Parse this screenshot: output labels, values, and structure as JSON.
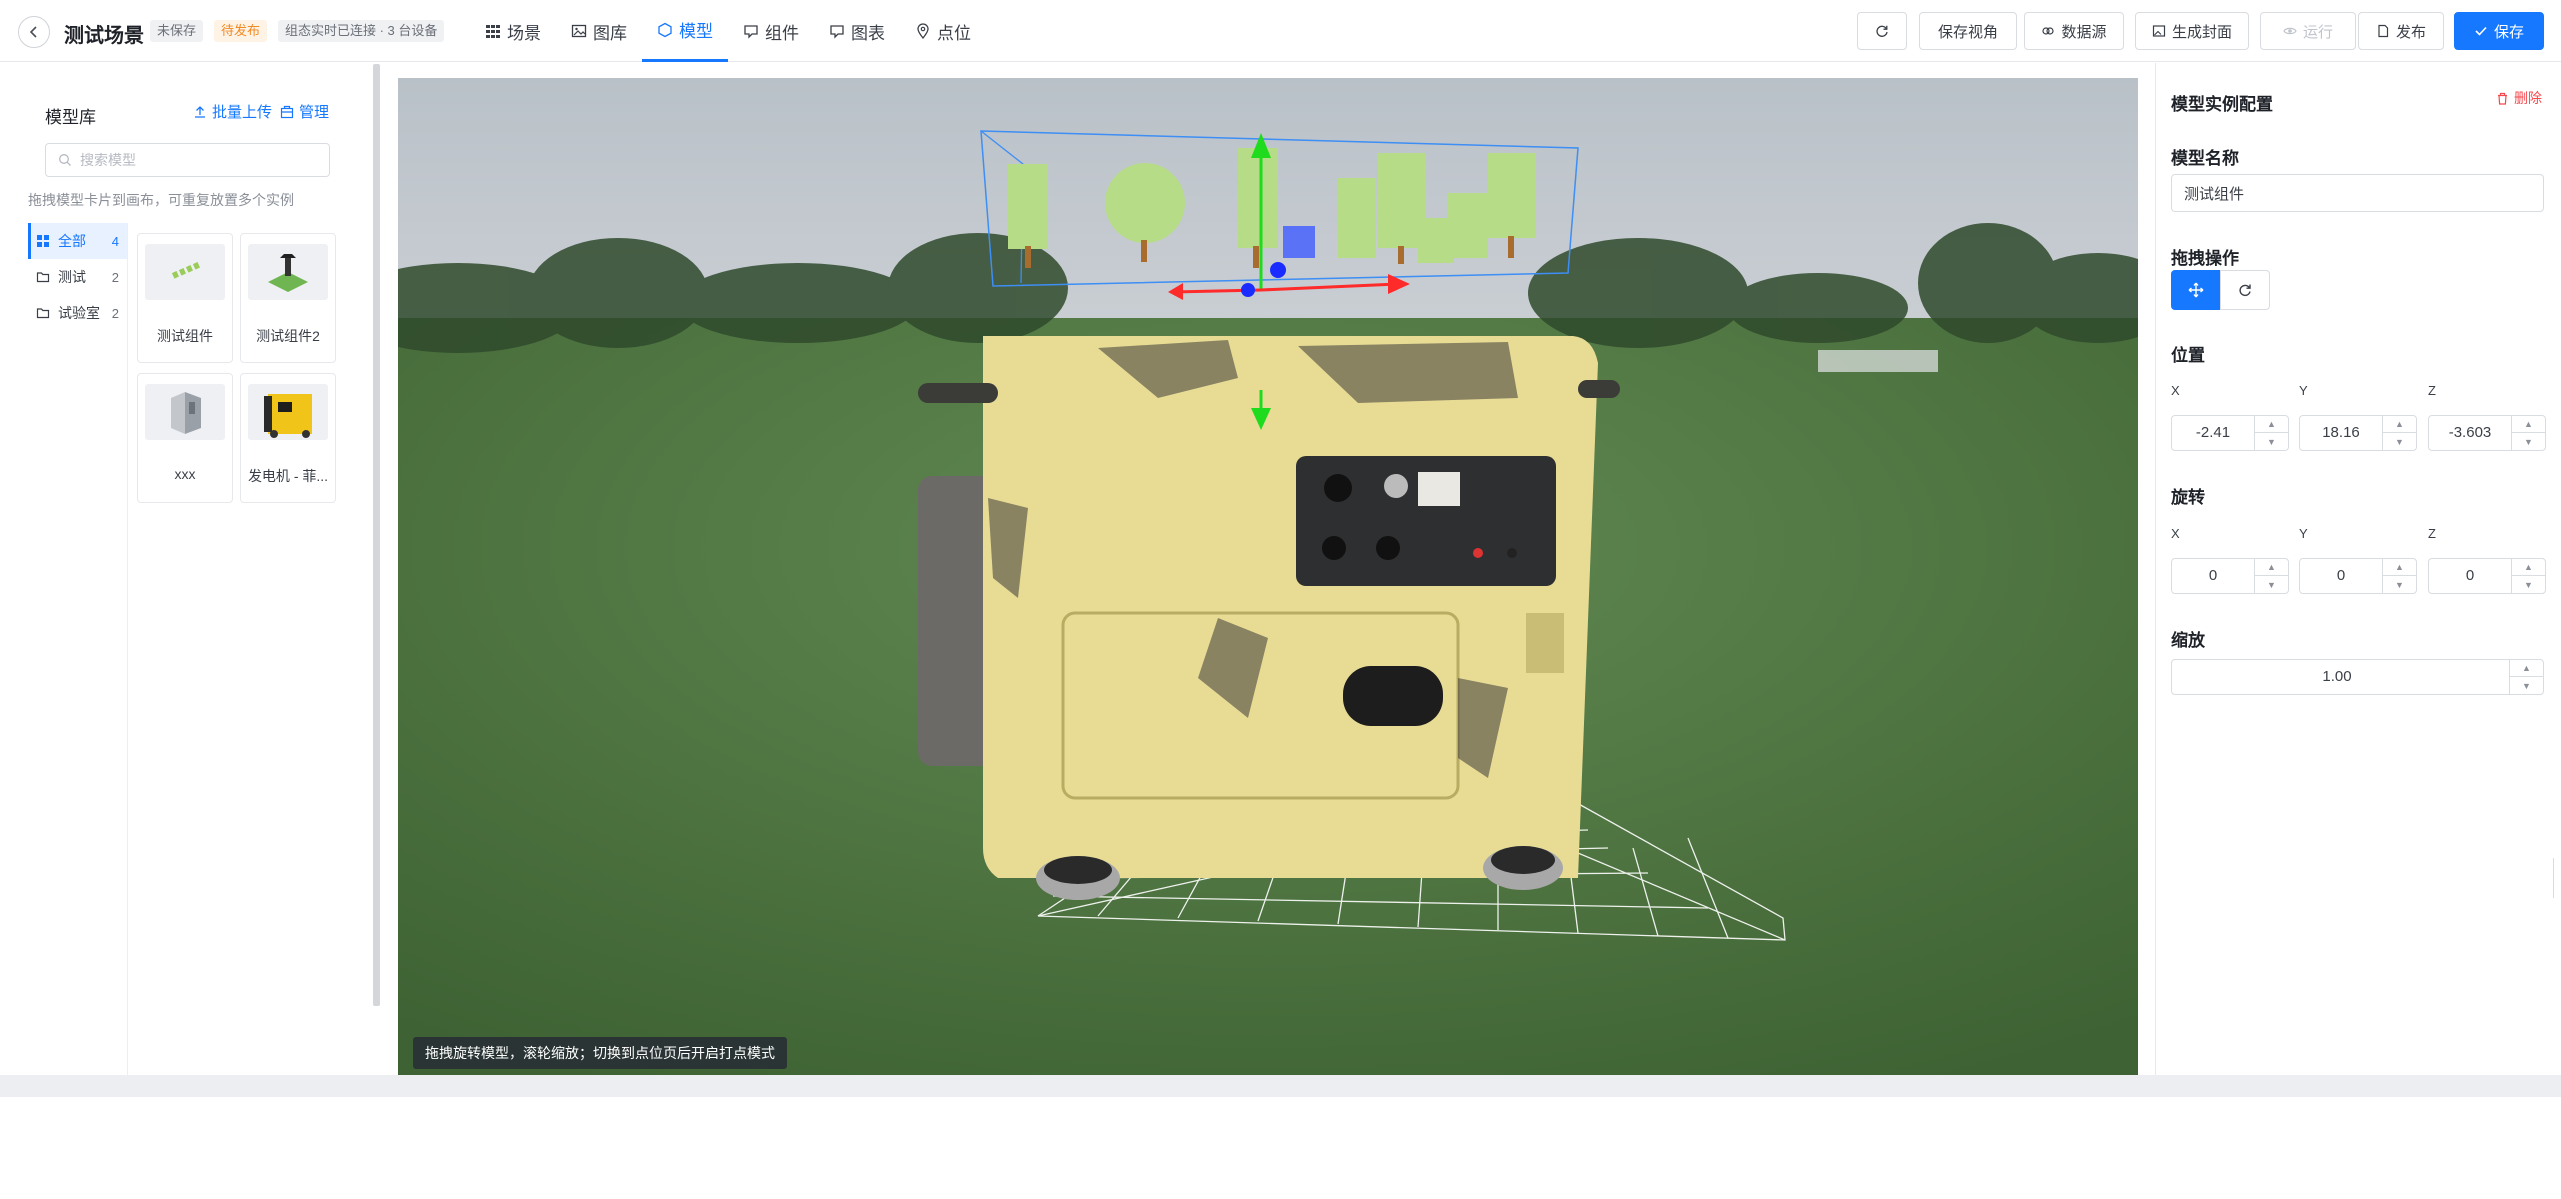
{
  "header": {
    "title": "测试场景",
    "badges": {
      "unsaved": "未保存",
      "pending": "待发布",
      "connection": "组态实时已连接 · 3 台设备"
    },
    "tabs": [
      {
        "label": "场景",
        "icon": "grid-icon"
      },
      {
        "label": "图库",
        "icon": "image-icon"
      },
      {
        "label": "模型",
        "icon": "cube-icon",
        "active": true
      },
      {
        "label": "组件",
        "icon": "component-icon"
      },
      {
        "label": "图表",
        "icon": "chart-icon"
      },
      {
        "label": "点位",
        "icon": "location-pin-icon"
      }
    ],
    "actions": {
      "refresh": "",
      "save_view": "保存视角",
      "datasource": "数据源",
      "cover": "生成封面",
      "run": "运行",
      "publish": "发布",
      "save": "保存"
    }
  },
  "library": {
    "title": "模型库",
    "batch_upload": "批量上传",
    "manage": "管理",
    "search_placeholder": "搜索模型",
    "hint": "拖拽模型卡片到画布，可重复放置多个实例",
    "categories": [
      {
        "label": "全部",
        "count": "4",
        "active": true
      },
      {
        "label": "测试",
        "count": "2"
      },
      {
        "label": "试验室",
        "count": "2"
      }
    ],
    "models": [
      {
        "label": "测试组件"
      },
      {
        "label": "测试组件2"
      },
      {
        "label": "xxx"
      },
      {
        "label": "发电机 - 菲..."
      }
    ]
  },
  "viewport": {
    "hint": "拖拽旋转模型，滚轮缩放；切换到点位页后开启打点模式"
  },
  "inspector": {
    "title": "模型实例配置",
    "delete": "删除",
    "name_label": "模型名称",
    "name_value": "测试组件",
    "drag_label": "拖拽操作",
    "position_label": "位置",
    "rotation_label": "旋转",
    "scale_label": "缩放",
    "axes": {
      "x": "X",
      "y": "Y",
      "z": "Z"
    },
    "position": {
      "x": "-2.41",
      "y": "18.16",
      "z": "-3.603"
    },
    "rotation": {
      "x": "0",
      "y": "0",
      "z": "0"
    },
    "scale": "1.00"
  },
  "colors": {
    "accent": "#1677ff",
    "danger": "#f5484d",
    "warning": "#f08a24"
  }
}
